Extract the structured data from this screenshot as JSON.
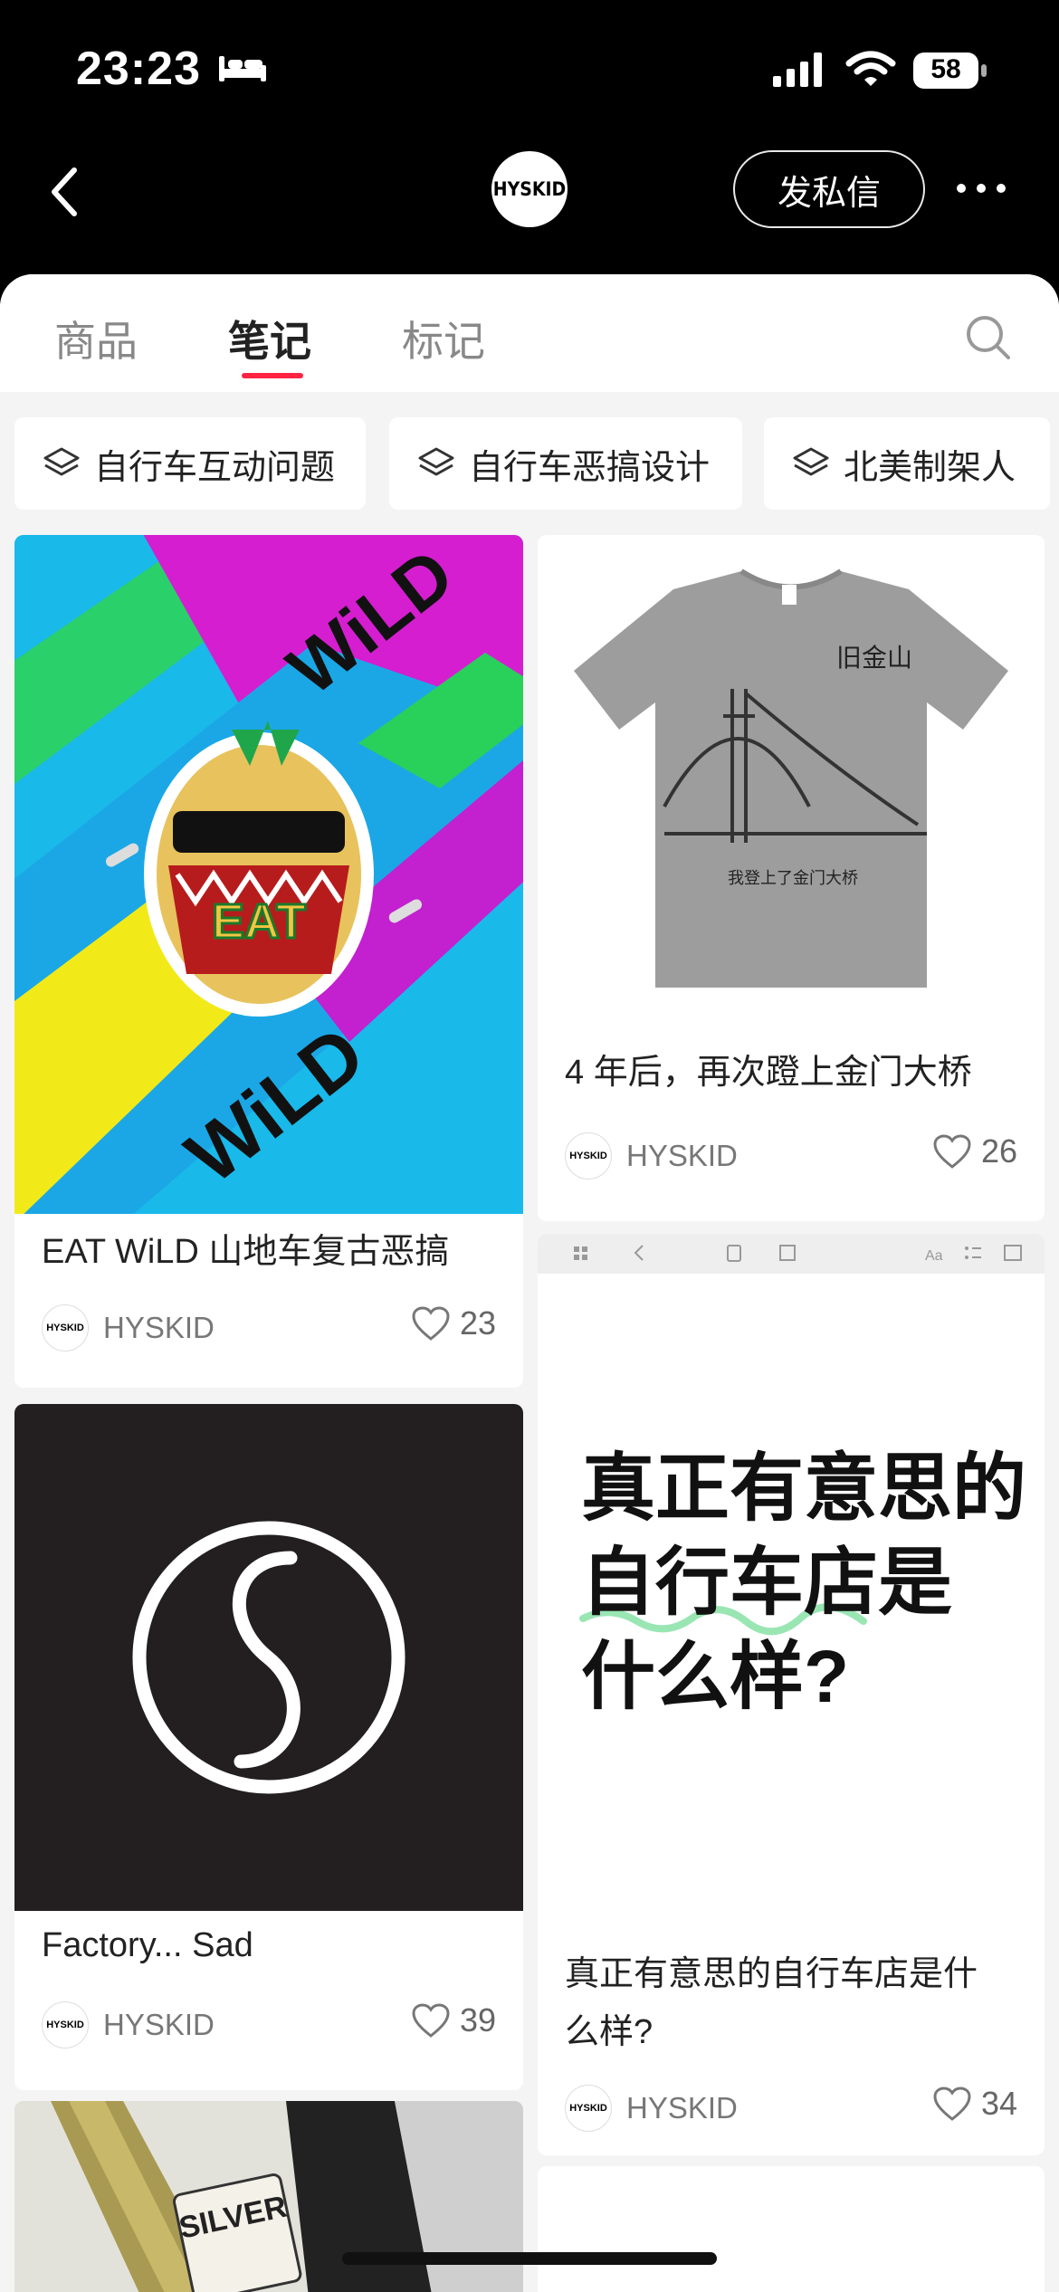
{
  "status_bar": {
    "time": "23:23",
    "battery": "58"
  },
  "header": {
    "logo_text": "HYSKID",
    "dm_button": "发私信"
  },
  "tabs": [
    {
      "label": "商品"
    },
    {
      "label": "笔记"
    },
    {
      "label": "标记"
    }
  ],
  "collections": [
    {
      "label": "自行车互动问题"
    },
    {
      "label": "自行车恶搞设计"
    },
    {
      "label": "北美制架人"
    }
  ],
  "notes": [
    {
      "title": "EAT WiLD 山地车复古恶搞",
      "author": "HYSKID",
      "likes": "23"
    },
    {
      "title": "4 年后，再次蹬上金门大桥",
      "author": "HYSKID",
      "likes": "26"
    },
    {
      "title": "Factory... Sad",
      "author": "HYSKID",
      "likes": "39"
    },
    {
      "title_line1": "真正有意思的自行车店是什",
      "title_line2": "么样?",
      "author": "HYSKID",
      "likes": "34"
    }
  ],
  "images": {
    "tshirt_print": "旧金山",
    "tshirt_caption": "我登上了金门大桥",
    "note_image_text_1": "真正有意思的",
    "note_image_text_2": "自行车店是",
    "note_image_text_3": "什么样?",
    "pin_text": "EAT",
    "stripe_text": "WiLD",
    "bike_sticker": "SILVER"
  },
  "colors": {
    "accent": "#ff2442",
    "background": "#f4f4f5"
  }
}
